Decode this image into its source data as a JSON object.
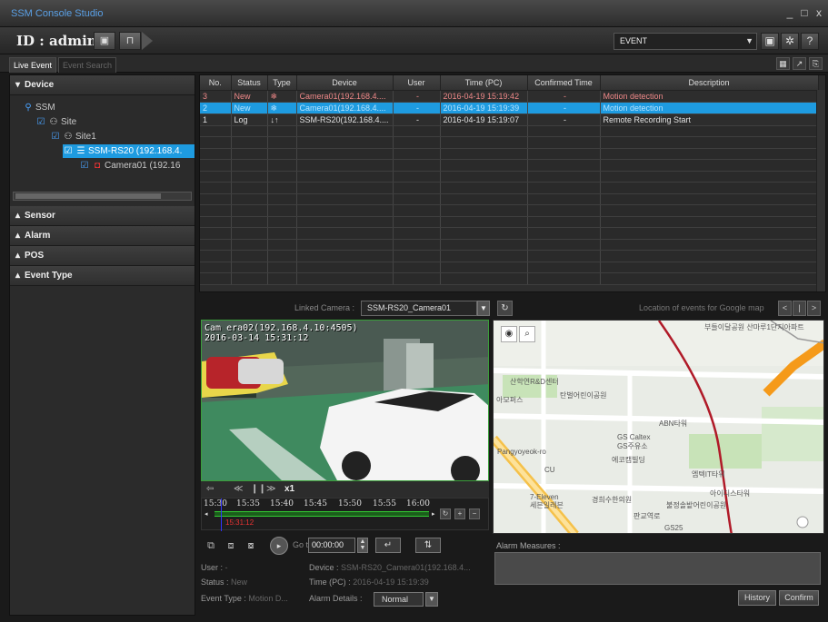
{
  "app": {
    "title": "SSM Console Studio"
  },
  "window_controls": {
    "minimize": "_",
    "maximize": "□",
    "close": "x"
  },
  "header": {
    "id_label": "ID : admin",
    "event_select": "EVENT",
    "help": "?"
  },
  "tabs": [
    {
      "label": "Live Event",
      "active": true
    },
    {
      "label": "Event Search",
      "active": false
    }
  ],
  "sidebar": {
    "device": {
      "title": "Device",
      "tree": [
        {
          "label": "SSM",
          "level": 0
        },
        {
          "label": "Site",
          "level": 1
        },
        {
          "label": "Site1",
          "level": 2
        },
        {
          "label": "SSM-RS20 (192.168.4.",
          "level": 3,
          "selected": true
        },
        {
          "label": "Camera01 (192.16",
          "level": 4
        }
      ]
    },
    "sections": [
      "Sensor",
      "Alarm",
      "POS",
      "Event Type"
    ]
  },
  "event_table": {
    "columns": [
      "No.",
      "Status",
      "Type",
      "Device",
      "User",
      "Time (PC)",
      "Confirmed Time",
      "Description"
    ],
    "rows": [
      {
        "no": "3",
        "status": "New",
        "type": "❄",
        "device": "Camera01(192.168.4....",
        "user": "-",
        "time": "2016-04-19 15:19:42",
        "confirmed": "-",
        "description": "Motion detection",
        "style": "new"
      },
      {
        "no": "2",
        "status": "New",
        "type": "❄",
        "device": "Camera01(192.168.4....",
        "user": "-",
        "time": "2016-04-19 15:19:39",
        "confirmed": "-",
        "description": "Motion detection",
        "style": "selected"
      },
      {
        "no": "1",
        "status": "Log",
        "type": "↓↑",
        "device": "SSM-RS20(192.168.4....",
        "user": "-",
        "time": "2016-04-19 15:19:07",
        "confirmed": "-",
        "description": "Remote Recording Start",
        "style": "log"
      }
    ]
  },
  "linked_camera": {
    "label": "Linked Camera :",
    "value": "SSM-RS20_Camera01"
  },
  "map_header": {
    "label": "Location of events for Google map"
  },
  "video": {
    "overlay_line1": "Cam era02(192.168.4.10:4505)",
    "overlay_line2": "2016-03-14 15:31:12",
    "speed": "x1"
  },
  "timeline": {
    "labels": [
      "15:30",
      "15:35",
      "15:40",
      "15:45",
      "15:50",
      "15:55",
      "16:00"
    ],
    "current_time": "15:31:12"
  },
  "playback": {
    "goto_label": "Go to",
    "goto_value": "00:00:00"
  },
  "event_info": {
    "user_label": "User :",
    "user_value": "-",
    "status_label": "Status :",
    "status_value": "New",
    "event_type_label": "Event Type :",
    "event_type_value": "Motion D...",
    "device_label": "Device :",
    "device_value": "SSM-RS20_Camera01(192.168.4...",
    "time_label": "Time (PC) :",
    "time_value": "2016-04-19 15:19:39",
    "alarm_details_label": "Alarm Details :",
    "alarm_details_value": "Normal"
  },
  "map": {
    "labels": [
      "산학연R&D센터",
      "아모퍼스",
      "ABN타워",
      "GS Caltex",
      "GS주유소",
      "에코캠빌딩",
      "CU",
      "엠텍IT타워",
      "7-Eleven",
      "세븐일레븐",
      "경희수한의원",
      "불정솔밭어린이공원",
      "탄벌어린이공원",
      "아이디스타워",
      "GS25",
      "부들이달공원 산마루1단지아파트",
      "판교역로",
      "Pangyoyeok-ro"
    ]
  },
  "alarm_measures": {
    "label": "Alarm Measures :"
  },
  "buttons": {
    "history": "History",
    "confirm": "Confirm"
  }
}
